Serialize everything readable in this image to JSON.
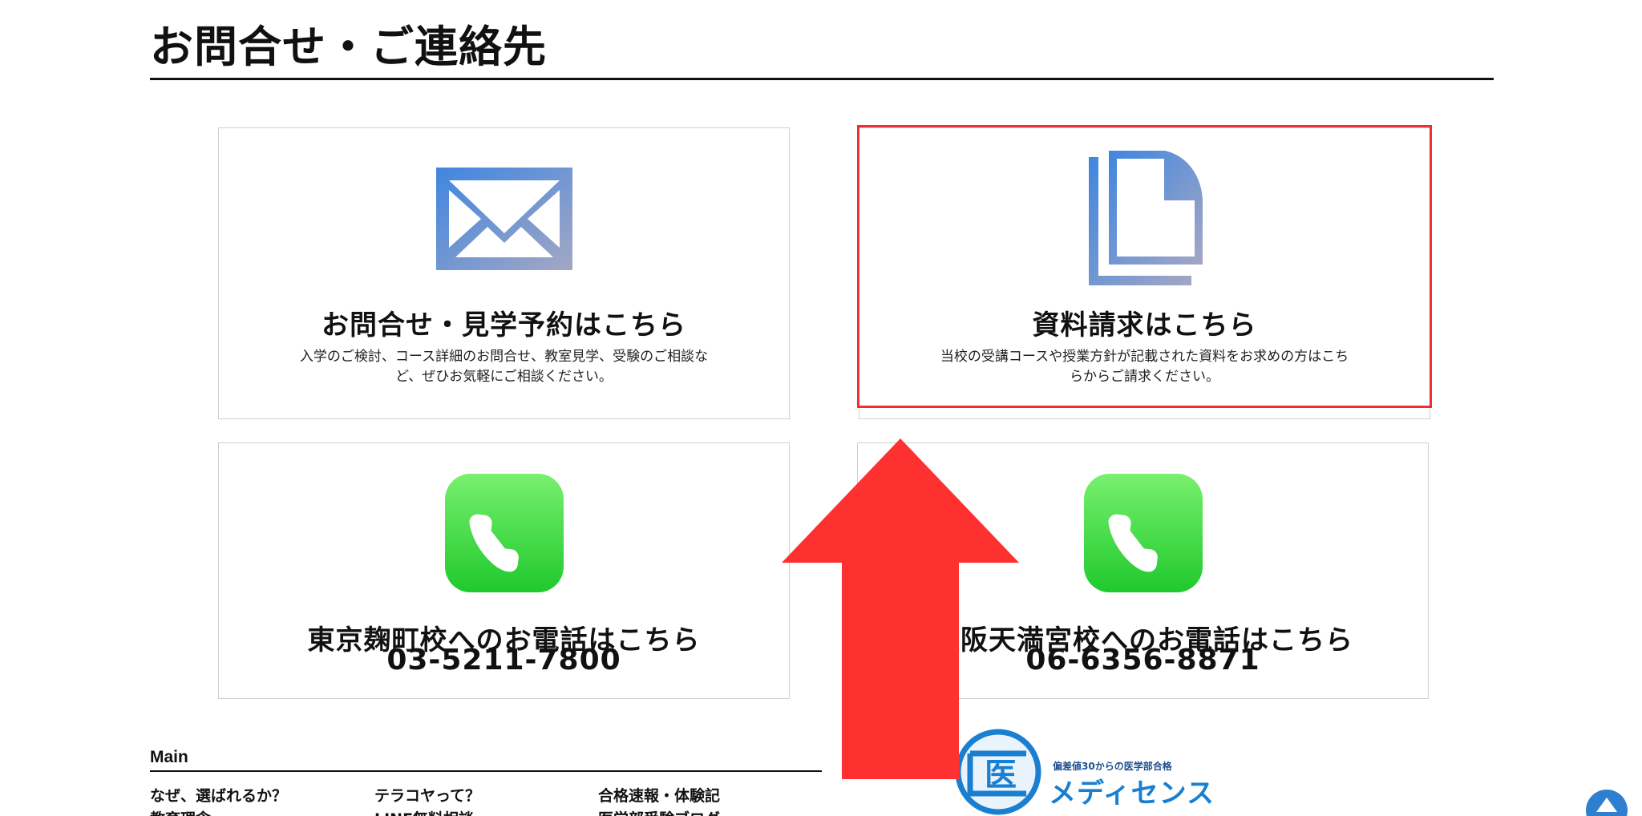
{
  "section": {
    "title": "お問合せ・ご連絡先"
  },
  "cards": [
    {
      "icon": "mail-icon",
      "heading": "お問合せ・見学予約はこちら",
      "description": "入学のご検討、コース詳細のお問合せ、教室見学、受験のご相談など、ぜひお気軽にご相談ください。"
    },
    {
      "icon": "document-icon",
      "heading": "資料請求はこちら",
      "description": "当校の受講コースや授業方針が記載された資料をお求めの方はこちらからご請求ください。"
    },
    {
      "icon": "phone-icon",
      "heading": "東京麹町校へのお電話はこちら",
      "phone": "03-5211-7800"
    },
    {
      "icon": "phone-icon",
      "heading": "大阪天満宮校へのお電話はこちら",
      "phone": "06-6356-8871"
    }
  ],
  "footer": {
    "heading": "Main",
    "links": [
      "なぜ、選ばれるか？",
      "テラコヤって？",
      "合格速報・体験記",
      "教育理念",
      "LINE無料相談",
      "医学部受験ブログ"
    ]
  },
  "logo": {
    "tagline": "偏差値30からの医学部合格",
    "name": "メディセンス",
    "mark_text": "医"
  },
  "colors": {
    "icon_gradient_start": "#3f86e0",
    "icon_gradient_end": "#a4a7c4",
    "phone_green_top": "#79f06e",
    "phone_green_bottom": "#1fc92d",
    "highlight_red": "#f03030",
    "arrow_red": "#ff3030",
    "logo_blue": "#1a7fd0"
  },
  "overlay": {
    "arrow": "up-arrow-annotation",
    "top_button": "scroll-top-button"
  }
}
